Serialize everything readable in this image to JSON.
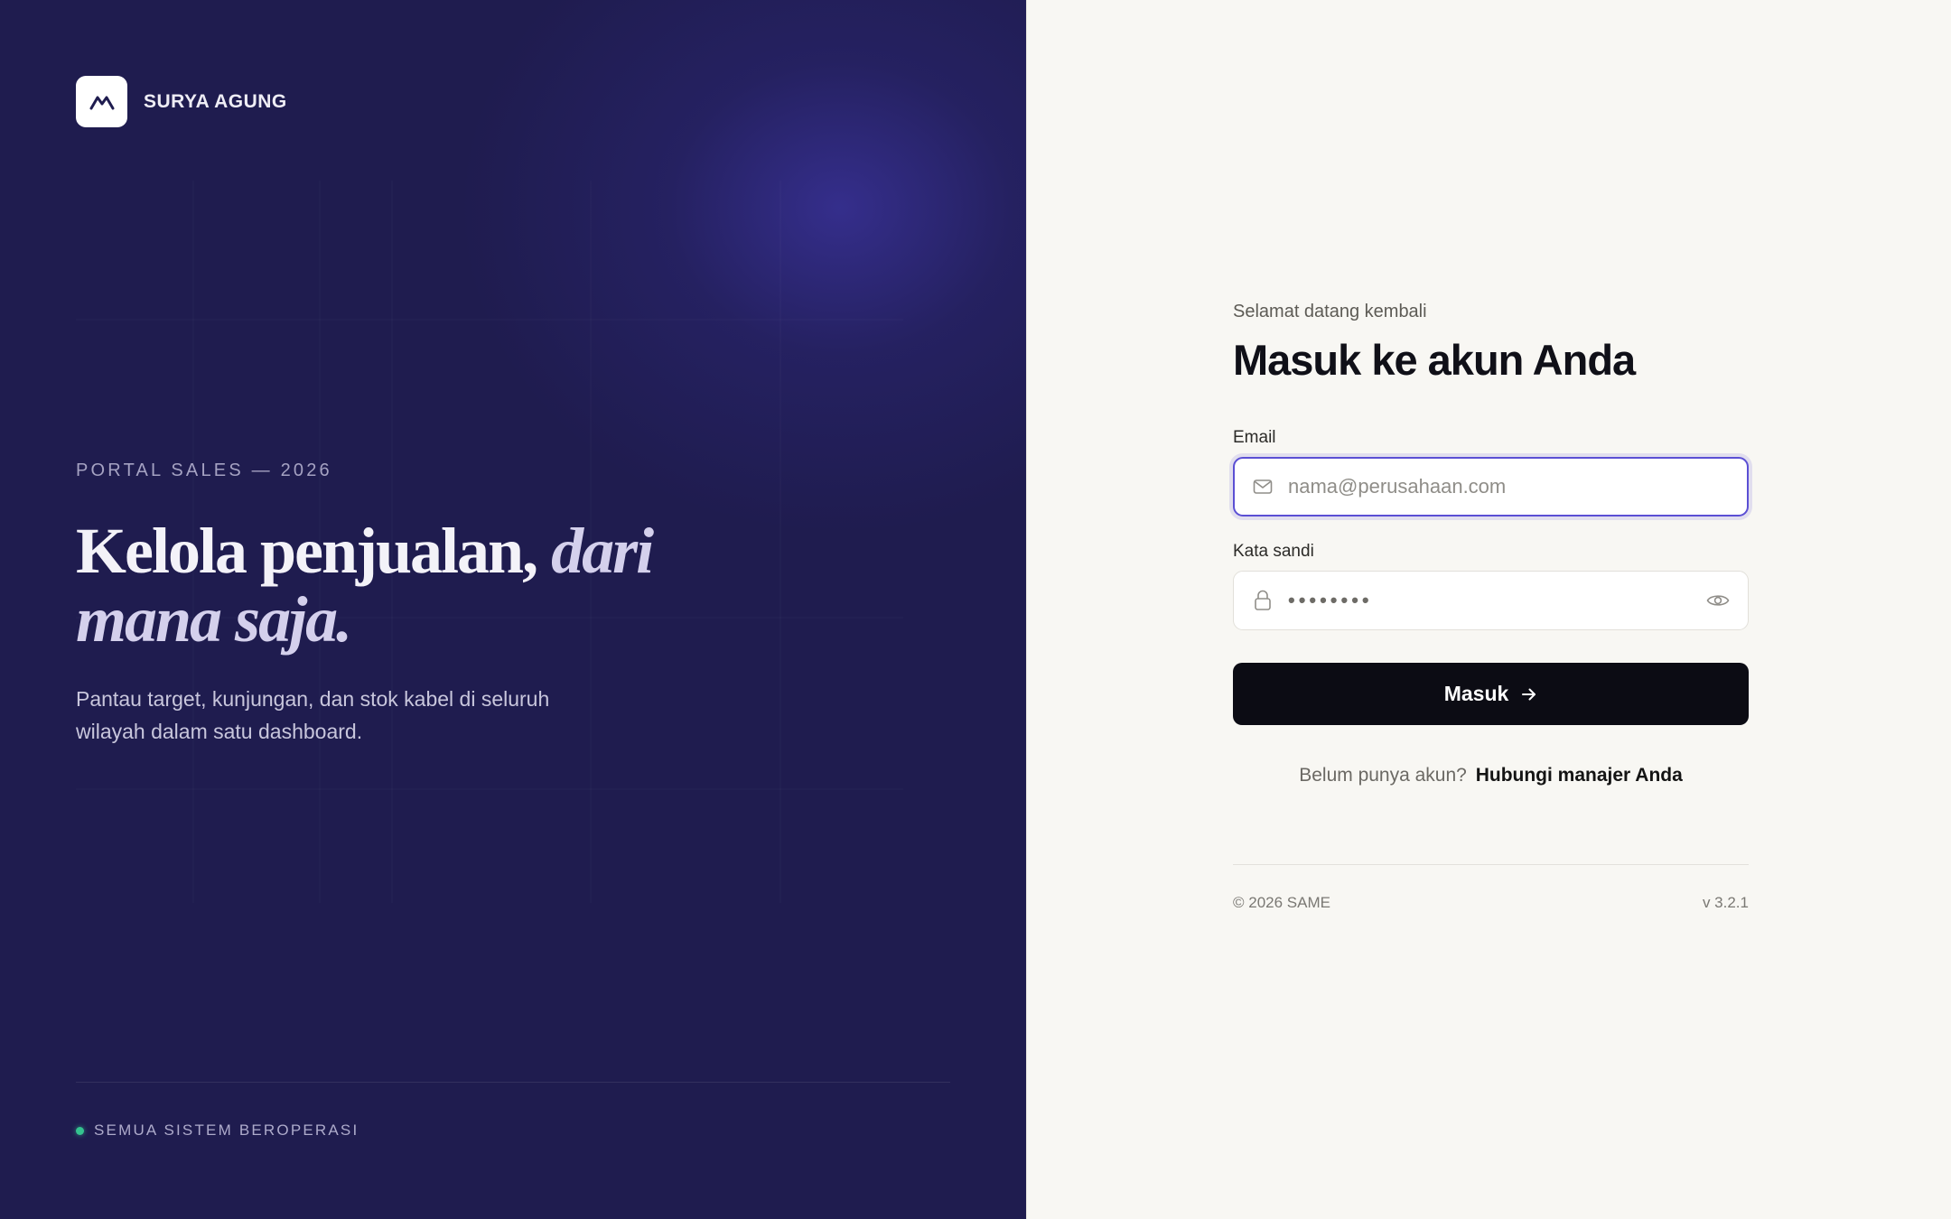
{
  "brand": {
    "name": "SURYA AGUNG",
    "logo_icon": "mountain-icon"
  },
  "hero": {
    "eyebrow": "PORTAL SALES — 2026",
    "headline_regular": "Kelola penjualan,",
    "headline_italic": "dari mana saja.",
    "subtext": "Pantau target, kunjungan, dan stok kabel di seluruh wilayah dalam satu dashboard."
  },
  "status": {
    "text": "SEMUA SISTEM BEROPERASI",
    "color": "#34c38f"
  },
  "login": {
    "greeting": "Selamat datang kembali",
    "title": "Masuk ke akun Anda",
    "email": {
      "label": "Email",
      "placeholder": "nama@perusahaan.com",
      "value": "",
      "icon": "mail-icon"
    },
    "password": {
      "label": "Kata sandi",
      "masked_value": "••••••••",
      "icon": "lock-icon",
      "toggle_icon": "eye-icon"
    },
    "submit_label": "Masuk",
    "signup_prompt": "Belum punya akun?",
    "signup_link": "Hubungi manajer Anda"
  },
  "footer": {
    "copyright": "© 2026 SAME",
    "version": "v 3.2.1"
  },
  "colors": {
    "left_bg": "#1f1c4f",
    "accent": "#5b4fd4",
    "button_bg": "#0c0c14",
    "right_bg": "#f8f7f3"
  }
}
